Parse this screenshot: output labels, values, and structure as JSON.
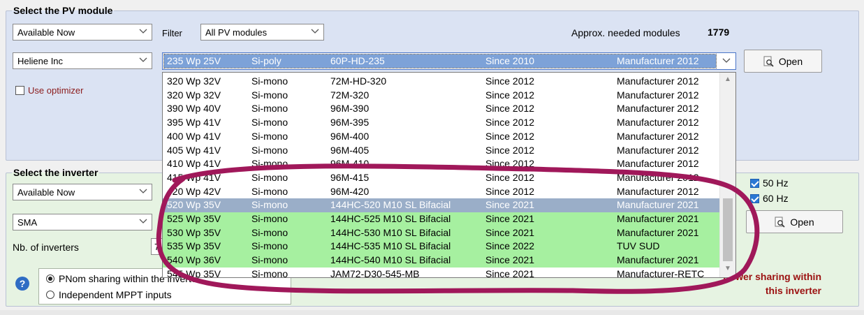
{
  "pv_section": {
    "legend": "Select the PV module",
    "availability": "Available Now",
    "filter_label": "Filter",
    "filter_value": "All PV modules",
    "needed_label": "Approx. needed modules",
    "needed_value": "1779",
    "manufacturer": "Heliene Inc",
    "optimizer_label": "Use optimizer",
    "open_label": "Open",
    "selected_module": {
      "power": "235 Wp 25V",
      "tech": "Si-poly",
      "model": "60P-HD-235",
      "since": "Since 2010",
      "source": "Manufacturer 2012"
    },
    "modules": [
      {
        "power": "320 Wp 32V",
        "tech": "Si-mono",
        "model": "72M-HD-320",
        "since": "Since 2012",
        "source": "Manufacturer 2012"
      },
      {
        "power": "320 Wp 32V",
        "tech": "Si-mono",
        "model": "72M-320",
        "since": "Since 2012",
        "source": "Manufacturer 2012"
      },
      {
        "power": "390 Wp 40V",
        "tech": "Si-mono",
        "model": "96M-390",
        "since": "Since 2012",
        "source": "Manufacturer 2012"
      },
      {
        "power": "395 Wp 41V",
        "tech": "Si-mono",
        "model": "96M-395",
        "since": "Since 2012",
        "source": "Manufacturer 2012"
      },
      {
        "power": "400 Wp 41V",
        "tech": "Si-mono",
        "model": "96M-400",
        "since": "Since 2012",
        "source": "Manufacturer 2012"
      },
      {
        "power": "405 Wp 41V",
        "tech": "Si-mono",
        "model": "96M-405",
        "since": "Since 2012",
        "source": "Manufacturer 2012"
      },
      {
        "power": "410 Wp 41V",
        "tech": "Si-mono",
        "model": "96M-410",
        "since": "Since 2012",
        "source": "Manufacturer 2012"
      },
      {
        "power": "415 Wp 41V",
        "tech": "Si-mono",
        "model": "96M-415",
        "since": "Since 2012",
        "source": "Manufacturer 2012"
      },
      {
        "power": "420 Wp 42V",
        "tech": "Si-mono",
        "model": "96M-420",
        "since": "Since 2012",
        "source": "Manufacturer 2012"
      },
      {
        "power": "520 Wp 35V",
        "tech": "Si-mono",
        "model": "144HC-520 M10 SL Bifacial",
        "since": "Since 2021",
        "source": "Manufacturer 2021"
      },
      {
        "power": "525 Wp 35V",
        "tech": "Si-mono",
        "model": "144HC-525 M10 SL Bifacial",
        "since": "Since 2021",
        "source": "Manufacturer 2021"
      },
      {
        "power": "530 Wp 35V",
        "tech": "Si-mono",
        "model": "144HC-530 M10 SL Bifacial",
        "since": "Since 2021",
        "source": "Manufacturer 2021"
      },
      {
        "power": "535 Wp 35V",
        "tech": "Si-mono",
        "model": "144HC-535 M10 SL Bifacial",
        "since": "Since 2022",
        "source": "TUV SUD"
      },
      {
        "power": "540 Wp 36V",
        "tech": "Si-mono",
        "model": "144HC-540 M10 SL Bifacial",
        "since": "Since 2021",
        "source": "Manufacturer 2021"
      },
      {
        "power": "545 Wp 35V",
        "tech": "Si-mono",
        "model": "JAM72-D30-545-MB",
        "since": "Since 2021",
        "source": "Manufacturer-RETC"
      }
    ]
  },
  "inverter_section": {
    "legend": "Select the inverter",
    "availability": "Available Now",
    "manufacturer": "SMA",
    "nb_inverters_label": "Nb. of inverters",
    "nb_inverters_value": "7",
    "hz50_label": "50 Hz",
    "hz60_label": "60 Hz",
    "open_label": "Open",
    "radio_pnom": "PNom sharing within the inverter",
    "radio_mppt": "Independent MPPT inputs",
    "power_note_line1": "Power sharing within",
    "power_note_line2": "this inverter"
  },
  "colors": {
    "pv_panel_bg": "#dbe3f3",
    "inverter_panel_bg": "#e6f3e2",
    "selected_row_bg": "#9aaec8",
    "highlight_row_bg": "#a6f0a0",
    "annotation_stroke": "#a0185a"
  }
}
